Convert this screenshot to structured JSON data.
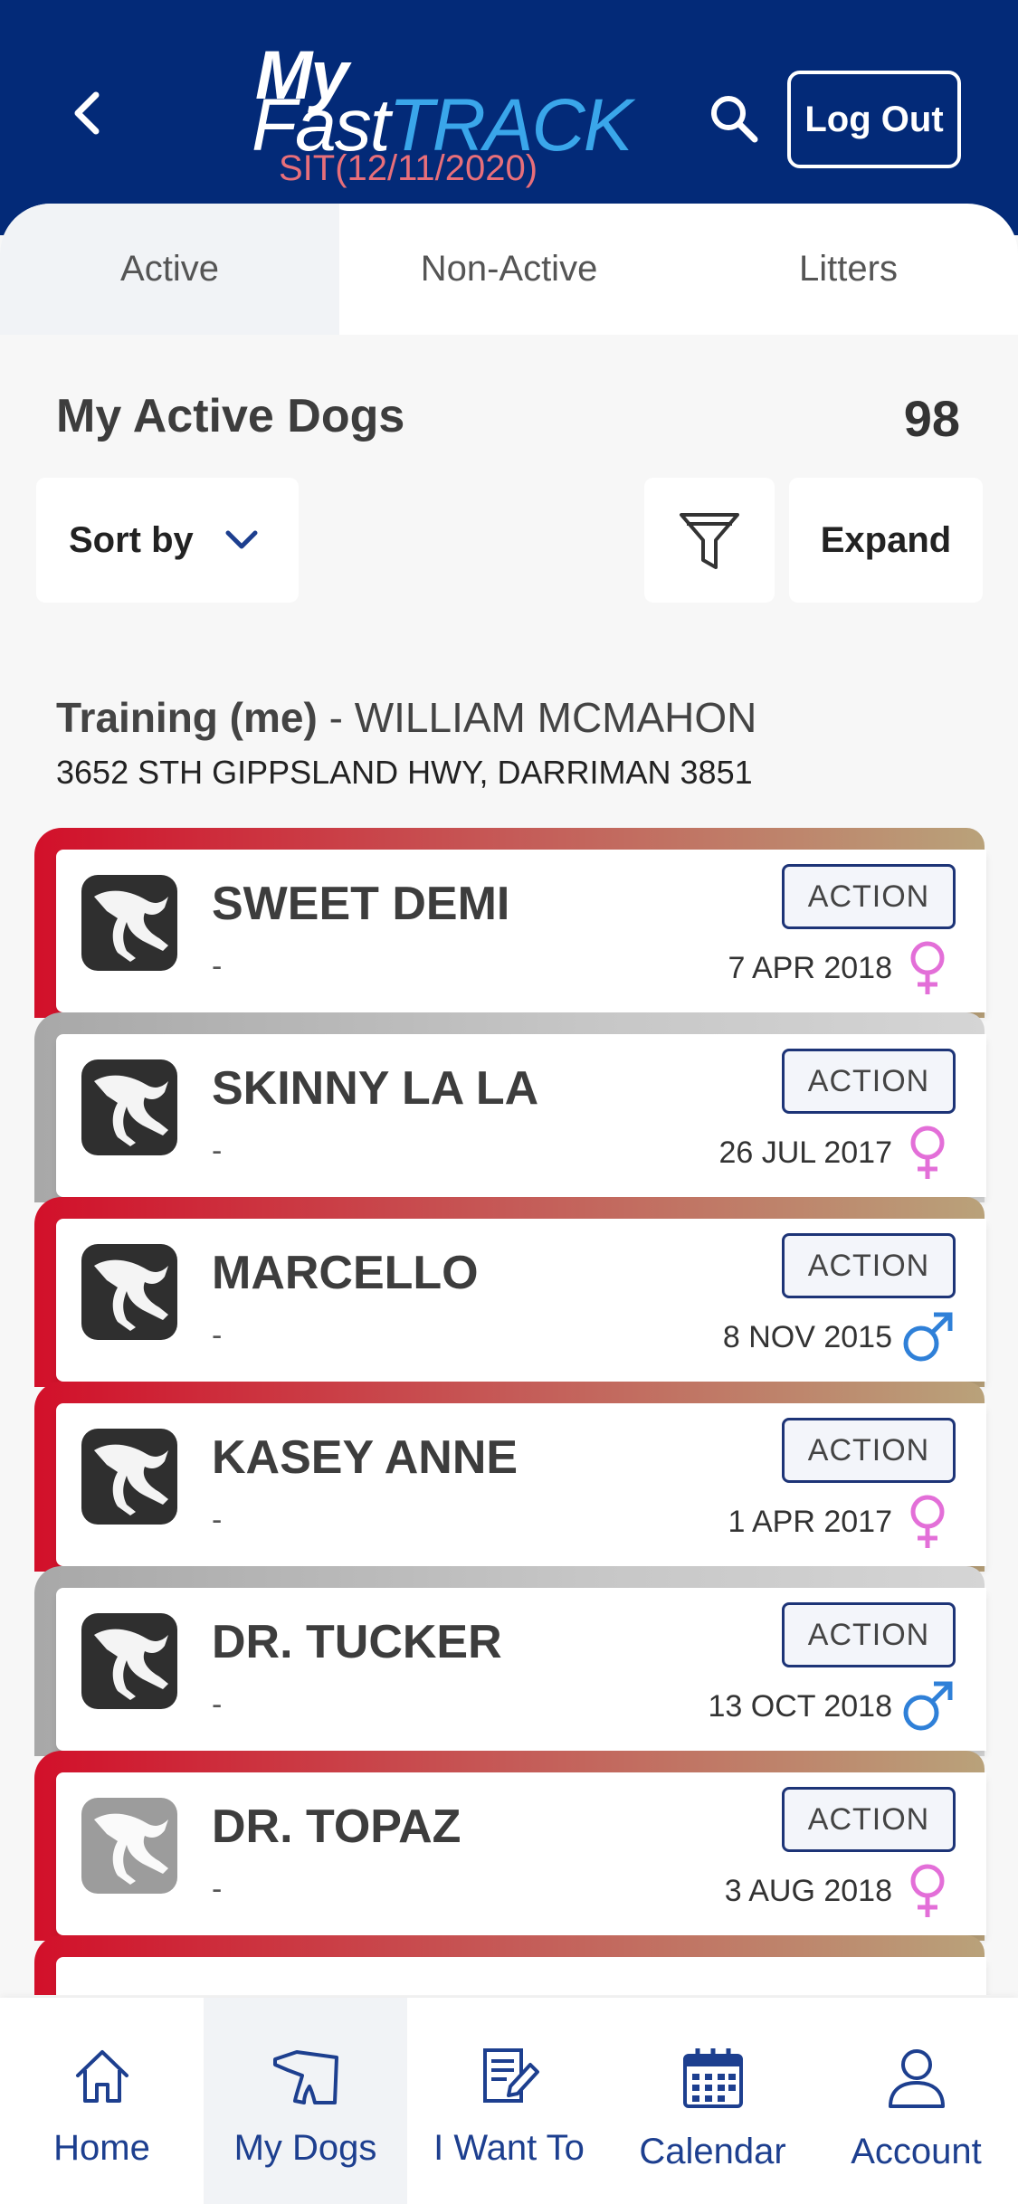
{
  "header": {
    "logo_my": "My",
    "logo_fast": "Fast",
    "logo_track": "TRACK",
    "environment": "SIT(12/11/2020)",
    "logout_label": "Log Out"
  },
  "tabs": [
    {
      "label": "Active",
      "active": true
    },
    {
      "label": "Non-Active",
      "active": false
    },
    {
      "label": "Litters",
      "active": false
    }
  ],
  "summary": {
    "title": "My Active Dogs",
    "count": "98",
    "sort_label": "Sort by",
    "expand_label": "Expand"
  },
  "trainer": {
    "role": "Training (me)",
    "separator": " - ",
    "name": "WILLIAM MCMAHON",
    "address": "3652 STH GIPPSLAND HWY, DARRIMAN 3851"
  },
  "dogs": [
    {
      "name": "SWEET DEMI",
      "subtitle": "-",
      "date": "7 APR 2018",
      "sex": "female",
      "status": "red",
      "action": "ACTION"
    },
    {
      "name": "SKINNY LA LA",
      "subtitle": "-",
      "date": "26 JUL 2017",
      "sex": "female",
      "status": "grey",
      "action": "ACTION"
    },
    {
      "name": "MARCELLO",
      "subtitle": "-",
      "date": "8 NOV 2015",
      "sex": "male",
      "status": "red",
      "action": "ACTION"
    },
    {
      "name": "KASEY ANNE",
      "subtitle": "-",
      "date": "1 APR 2017",
      "sex": "female",
      "status": "red",
      "action": "ACTION"
    },
    {
      "name": "DR. TUCKER",
      "subtitle": "-",
      "date": "13 OCT 2018",
      "sex": "male",
      "status": "grey",
      "action": "ACTION"
    },
    {
      "name": "DR. TOPAZ",
      "subtitle": "-",
      "date": "3 AUG 2018",
      "sex": "female",
      "status": "red",
      "action": "ACTION"
    }
  ],
  "bottom_nav": [
    {
      "label": "Home",
      "icon": "home-icon",
      "active": false
    },
    {
      "label": "My Dogs",
      "icon": "dog-icon",
      "active": true
    },
    {
      "label": "I Want To",
      "icon": "edit-document-icon",
      "active": false
    },
    {
      "label": "Calendar",
      "icon": "calendar-icon",
      "active": false
    },
    {
      "label": "Account",
      "icon": "account-icon",
      "active": false
    }
  ],
  "colors": {
    "header_bg": "#032a78",
    "track_blue": "#3aa6ea",
    "env_pink": "#e86f7a",
    "status_red": "#d2102a",
    "status_grey": "#a8a8a8",
    "female": "#e36fd8",
    "male": "#2f80d8",
    "nav_blue": "#1d3f8f"
  }
}
